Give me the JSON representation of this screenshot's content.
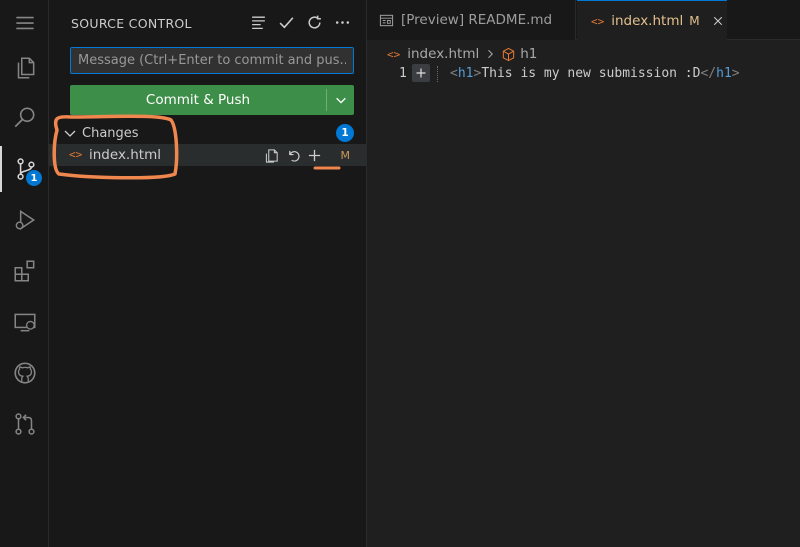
{
  "activity_bar": {
    "items": [
      {
        "icon": "menu-icon"
      },
      {
        "icon": "explorer-icon"
      },
      {
        "icon": "search-icon"
      },
      {
        "icon": "source-control-icon",
        "badge": "1"
      },
      {
        "icon": "run-debug-icon"
      },
      {
        "icon": "extensions-icon"
      },
      {
        "icon": "remote-explorer-icon"
      },
      {
        "icon": "github-icon"
      },
      {
        "icon": "pull-request-icon"
      }
    ]
  },
  "sidebar": {
    "title": "SOURCE CONTROL",
    "actions": [
      "view-as-tree-icon",
      "check-icon",
      "refresh-icon",
      "more-icon"
    ],
    "commit_input": {
      "value": "",
      "placeholder": "Message (Ctrl+Enter to commit and pus..."
    },
    "commit_button": {
      "label": "Commit & Push"
    },
    "changes": {
      "label": "Changes",
      "count": "1",
      "files": [
        {
          "icon": "<>",
          "name": "index.html",
          "status": "M"
        }
      ]
    },
    "row_actions": [
      "open-file-icon",
      "discard-icon",
      "stage-icon"
    ]
  },
  "editor": {
    "tabs": [
      {
        "label": "[Preview] README.md",
        "icon": "preview-icon",
        "active": false
      },
      {
        "label": "index.html",
        "icon": "<>",
        "status": "M",
        "active": true
      }
    ],
    "breadcrumb": {
      "file": "index.html",
      "file_icon": "<>",
      "symbol": "h1"
    },
    "lines": [
      {
        "number": "1",
        "tokens": [
          {
            "t": "<",
            "k": "br"
          },
          {
            "t": "h1",
            "k": "tag"
          },
          {
            "t": ">",
            "k": "br"
          },
          {
            "t": "This is my new submission :D",
            "k": "txt"
          },
          {
            "t": "</",
            "k": "br"
          },
          {
            "t": "h1",
            "k": "tag"
          },
          {
            "t": ">",
            "k": "br"
          }
        ]
      }
    ]
  },
  "colors": {
    "accent": "#0078d4",
    "commit_button": "#3d8e48",
    "annotation": "#f0874f",
    "modified": "#e2c08d"
  }
}
